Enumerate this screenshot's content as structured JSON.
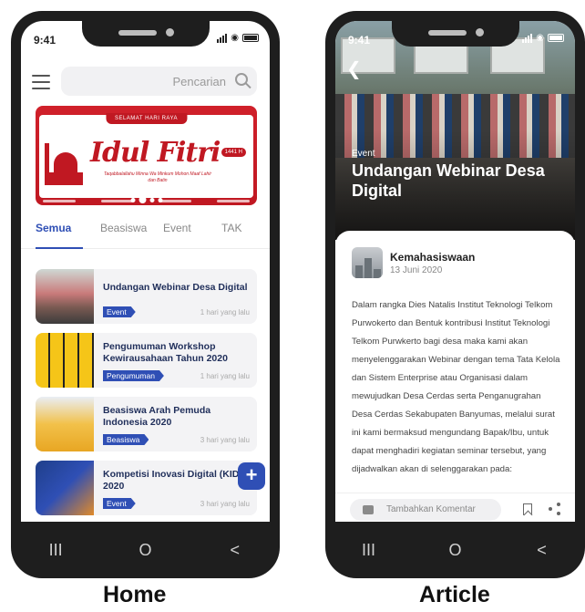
{
  "status": {
    "time": "9:41"
  },
  "home": {
    "search_placeholder": "Pencarian",
    "banner": {
      "ribbon": "SELAMAT HARI RAYA",
      "title": "Idul Fitri",
      "hijri": "1441 H",
      "subtitle": "Taqabbalallahu Minna Wa Minkum Mohon Maaf Lahir dan Batin"
    },
    "tabs": [
      "Semua",
      "Beasiswa",
      "Event",
      "TAK"
    ],
    "active_tab": "Semua",
    "cards": [
      {
        "title": "Undangan Webinar Desa Digital",
        "badge": "Event",
        "time": "1 hari yang lalu"
      },
      {
        "title": "Pengumuman Workshop Kewirausahaan Tahun 2020",
        "badge": "Pengumuman",
        "time": "1 hari yang lalu"
      },
      {
        "title": "Beasiswa Arah Pemuda Indonesia 2020",
        "badge": "Beasiswa",
        "time": "3 hari yang lalu"
      },
      {
        "title": "Kompetisi Inovasi Digital (KID) 2020",
        "badge": "Event",
        "time": "3 hari yang lalu"
      }
    ],
    "fab_icon": "+",
    "caption": "Home"
  },
  "article": {
    "category": "Event",
    "title": "Undangan Webinar Desa Digital",
    "author": "Kemahasiswaan",
    "date": "13 Juni 2020",
    "paragraph": "Dalam rangka Dies Natalis Institut Teknologi Telkom Purwokerto dan Bentuk kontribusi Institut Teknologi Telkom Purwkerto bagi desa maka kami akan menyelenggarakan Webinar dengan tema Tata Kelola dan Sistem Enterprise atau Organisasi dalam mewujudkan Desa Cerdas serta Penganugrahan Desa Cerdas Sekabupaten Banyumas, melalui surat ini kami bermaksud mengundang Bapak/Ibu, untuk dapat menghadiri kegiatan seminar tersebut, yang dijadwalkan akan di selenggarakan pada:",
    "comment_placeholder": "Tambahkan Komentar",
    "caption": "Article"
  },
  "navbar": {
    "recent": "III",
    "home": "O",
    "back": "<"
  },
  "colors": {
    "accent": "#2f4fb5",
    "banner_red": "#c01822",
    "card_bg": "#f3f3f5"
  }
}
